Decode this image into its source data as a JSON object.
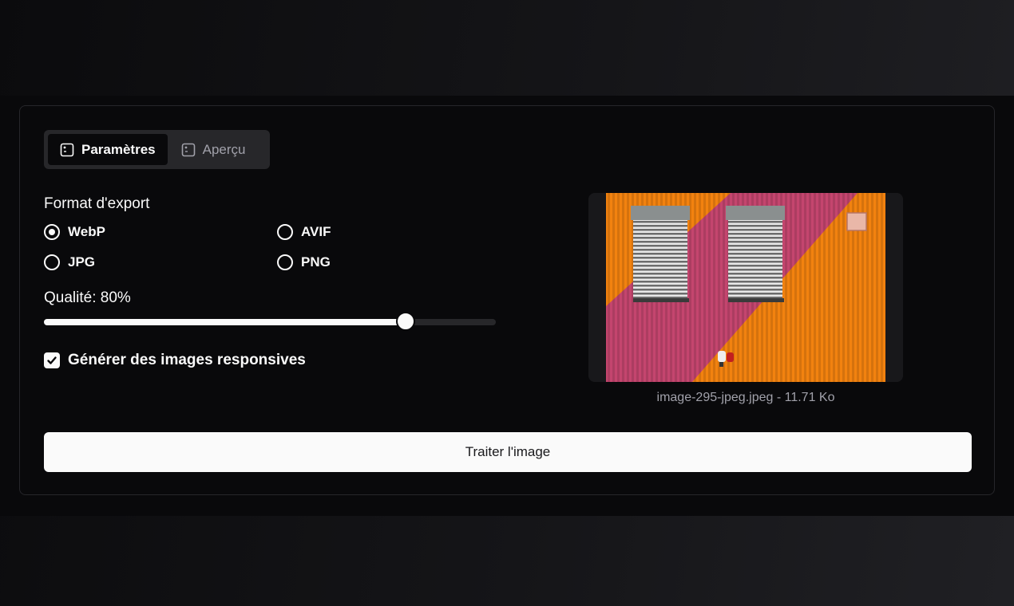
{
  "tabs": [
    {
      "label": "Paramètres",
      "active": true
    },
    {
      "label": "Aperçu",
      "active": false
    }
  ],
  "export_format": {
    "label": "Format d'export",
    "options": [
      "WebP",
      "AVIF",
      "JPG",
      "PNG"
    ],
    "selected": "WebP"
  },
  "quality": {
    "label": "Qualité: 80%",
    "value": 80,
    "min": 0,
    "max": 100
  },
  "responsive": {
    "label": "Générer des images responsives",
    "checked": true
  },
  "preview": {
    "caption": "image-295-jpeg.jpeg - 11.71 Ko"
  },
  "actions": {
    "process_label": "Traiter l'image"
  },
  "colors": {
    "accent": "#fafafa",
    "background": "#09090b",
    "muted": "#27272a",
    "photo_orange": "#f2820f",
    "photo_magenta": "#c4456e"
  },
  "icons": {
    "tab_settings": "image-frame-icon",
    "tab_preview": "image-frame-icon"
  }
}
